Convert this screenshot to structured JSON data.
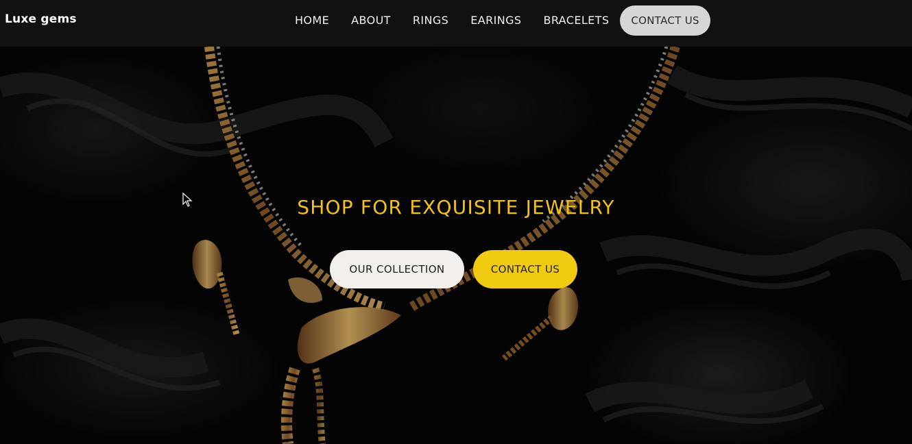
{
  "brand": {
    "name": "Luxe gems"
  },
  "nav": {
    "links": [
      "HOME",
      "ABOUT",
      "RINGS",
      "EARINGS",
      "BRACELETS"
    ],
    "cta_label": "CONTACT US"
  },
  "hero": {
    "headline": "SHOP FOR EXQUISITE JEWELRY",
    "primary_button": "OUR COLLECTION",
    "secondary_button": "CONTACT US"
  },
  "colors": {
    "nav_background": "#111111",
    "accent_gold": "#f2c21b",
    "button_yellow": "#f1cb11",
    "button_light": "#f3f0ec",
    "nav_cta_background": "#d6d6d6"
  }
}
